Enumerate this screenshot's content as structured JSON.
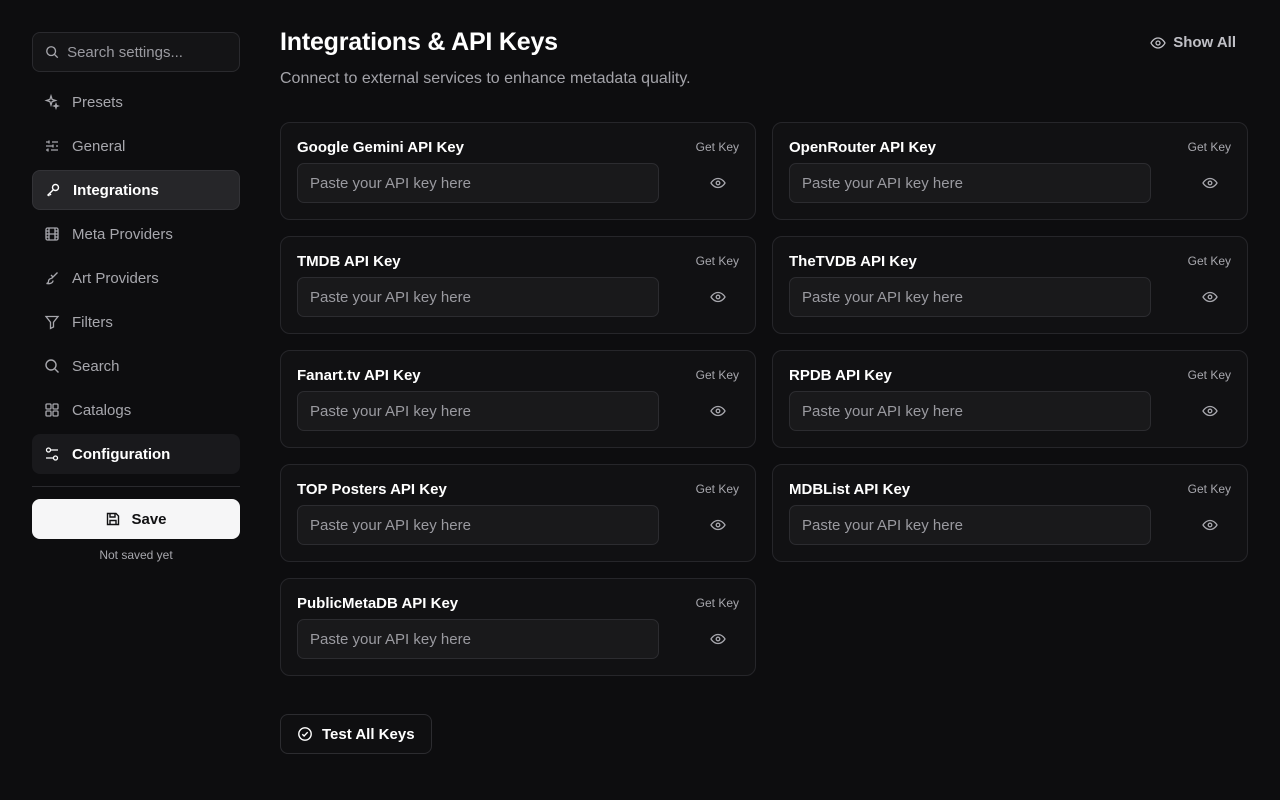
{
  "sidebar": {
    "search_placeholder": "Search settings...",
    "items": [
      {
        "label": "Presets",
        "icon": "sparkles-icon"
      },
      {
        "label": "General",
        "icon": "sliders-icon"
      },
      {
        "label": "Integrations",
        "icon": "key-icon",
        "active": true
      },
      {
        "label": "Meta Providers",
        "icon": "film-icon"
      },
      {
        "label": "Art Providers",
        "icon": "paintbrush-icon"
      },
      {
        "label": "Filters",
        "icon": "filter-icon"
      },
      {
        "label": "Search",
        "icon": "search-icon"
      },
      {
        "label": "Catalogs",
        "icon": "grid-icon"
      },
      {
        "label": "Configuration",
        "icon": "settings-sliders-icon"
      }
    ],
    "save_label": "Save",
    "save_status": "Not saved yet"
  },
  "main": {
    "title": "Integrations & API Keys",
    "subtitle": "Connect to external services to enhance metadata quality.",
    "show_all_label": "Show All",
    "get_key_label": "Get Key",
    "input_placeholder": "Paste your API key here",
    "cards": [
      {
        "title": "Google Gemini API Key"
      },
      {
        "title": "OpenRouter API Key"
      },
      {
        "title": "TMDB API Key"
      },
      {
        "title": "TheTVDB API Key"
      },
      {
        "title": "Fanart.tv API Key"
      },
      {
        "title": "RPDB API Key"
      },
      {
        "title": "TOP Posters API Key"
      },
      {
        "title": "MDBList API Key"
      },
      {
        "title": "PublicMetaDB API Key"
      }
    ],
    "test_all_label": "Test All Keys"
  },
  "colors": {
    "background": "#0d0d0f",
    "card": "#111113",
    "save_button": "#f6f6f7",
    "active_nav": "#262629"
  }
}
